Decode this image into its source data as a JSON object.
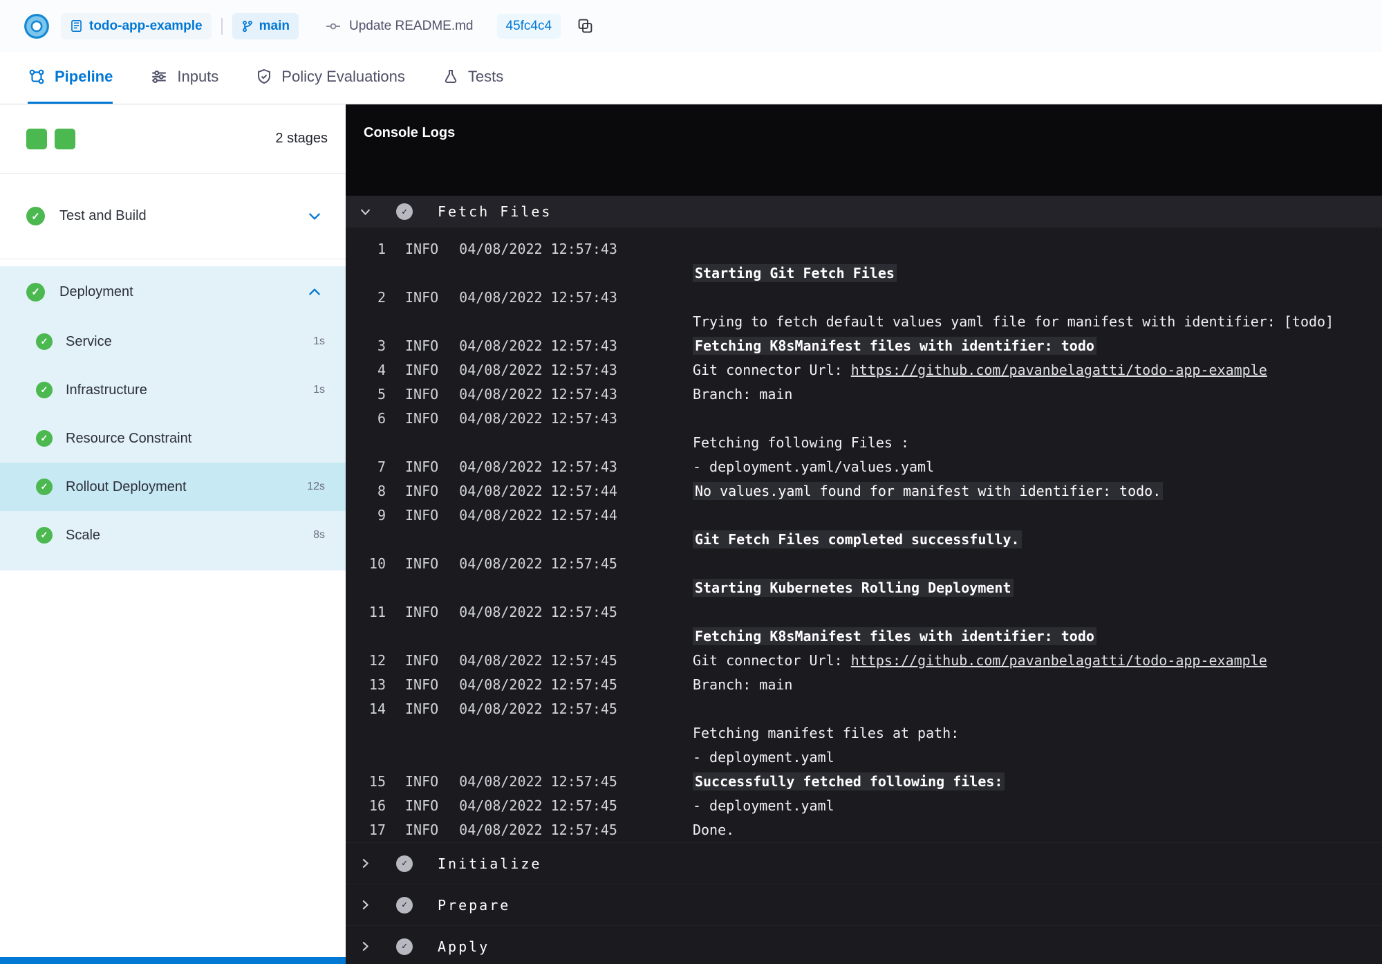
{
  "topbar": {
    "repo": "todo-app-example",
    "branch": "main",
    "commit_message": "Update README.md",
    "commit_hash": "45fc4c4"
  },
  "tabs": [
    {
      "label": "Pipeline",
      "active": true
    },
    {
      "label": "Inputs",
      "active": false
    },
    {
      "label": "Policy Evaluations",
      "active": false
    },
    {
      "label": "Tests",
      "active": false
    }
  ],
  "sidebar": {
    "stages_count_label": "2 stages",
    "stage_collapsed": {
      "label": "Test and Build"
    },
    "stage_expanded": {
      "label": "Deployment"
    },
    "deployment_steps": [
      {
        "label": "Service",
        "duration": "1s",
        "selected": false
      },
      {
        "label": "Infrastructure",
        "duration": "1s",
        "selected": false
      },
      {
        "label": "Resource Constraint",
        "duration": "",
        "selected": false
      },
      {
        "label": "Rollout Deployment",
        "duration": "12s",
        "selected": true
      },
      {
        "label": "Scale",
        "duration": "8s",
        "selected": false
      }
    ]
  },
  "console": {
    "title": "Console Logs",
    "expanded_section": "Fetch Files",
    "collapsed_sections": [
      "Initialize",
      "Prepare",
      "Apply"
    ],
    "log_entries": [
      {
        "n": 1,
        "lvl": "INFO",
        "ts": "04/08/2022 12:57:43",
        "lines": [
          [],
          [
            {
              "t": "Starting Git Fetch Files",
              "s": "hl"
            }
          ]
        ]
      },
      {
        "n": 2,
        "lvl": "INFO",
        "ts": "04/08/2022 12:57:43",
        "lines": [
          [],
          [
            {
              "t": "Trying to fetch default values yaml file for manifest with identifier: [todo]",
              "s": "plain"
            }
          ]
        ]
      },
      {
        "n": 3,
        "lvl": "INFO",
        "ts": "04/08/2022 12:57:43",
        "lines": [
          [
            {
              "t": "Fetching K8sManifest files with identifier: todo",
              "s": "hl"
            }
          ]
        ]
      },
      {
        "n": 4,
        "lvl": "INFO",
        "ts": "04/08/2022 12:57:43",
        "lines": [
          [
            {
              "t": "Git connector Url: ",
              "s": "plain"
            },
            {
              "t": "https://github.com/pavanbelagatti/todo-app-example",
              "s": "link"
            }
          ]
        ]
      },
      {
        "n": 5,
        "lvl": "INFO",
        "ts": "04/08/2022 12:57:43",
        "lines": [
          [
            {
              "t": "Branch: main",
              "s": "plain"
            }
          ]
        ]
      },
      {
        "n": 6,
        "lvl": "INFO",
        "ts": "04/08/2022 12:57:43",
        "lines": [
          [],
          [
            {
              "t": "Fetching following Files :",
              "s": "plain"
            }
          ]
        ]
      },
      {
        "n": 7,
        "lvl": "INFO",
        "ts": "04/08/2022 12:57:43",
        "lines": [
          [
            {
              "t": "- deployment.yaml/values.yaml",
              "s": "plain"
            }
          ]
        ]
      },
      {
        "n": 8,
        "lvl": "INFO",
        "ts": "04/08/2022 12:57:44",
        "lines": [
          [
            {
              "t": "No values.yaml found for manifest with identifier: todo.",
              "s": "hlplain"
            }
          ]
        ]
      },
      {
        "n": 9,
        "lvl": "INFO",
        "ts": "04/08/2022 12:57:44",
        "lines": [
          [],
          [
            {
              "t": "Git Fetch Files completed successfully.",
              "s": "hl"
            }
          ]
        ]
      },
      {
        "n": 10,
        "lvl": "INFO",
        "ts": "04/08/2022 12:57:45",
        "lines": [
          [],
          [
            {
              "t": "Starting Kubernetes Rolling Deployment",
              "s": "hl"
            }
          ]
        ]
      },
      {
        "n": 11,
        "lvl": "INFO",
        "ts": "04/08/2022 12:57:45",
        "lines": [
          [],
          [
            {
              "t": "Fetching K8sManifest files with identifier: todo",
              "s": "hl"
            }
          ]
        ]
      },
      {
        "n": 12,
        "lvl": "INFO",
        "ts": "04/08/2022 12:57:45",
        "lines": [
          [
            {
              "t": "Git connector Url: ",
              "s": "plain"
            },
            {
              "t": "https://github.com/pavanbelagatti/todo-app-example",
              "s": "link"
            }
          ]
        ]
      },
      {
        "n": 13,
        "lvl": "INFO",
        "ts": "04/08/2022 12:57:45",
        "lines": [
          [
            {
              "t": "Branch: main",
              "s": "plain"
            }
          ]
        ]
      },
      {
        "n": 14,
        "lvl": "INFO",
        "ts": "04/08/2022 12:57:45",
        "lines": [
          [],
          [
            {
              "t": "Fetching manifest files at path:",
              "s": "plain"
            }
          ],
          [
            {
              "t": "- deployment.yaml",
              "s": "plain"
            }
          ]
        ]
      },
      {
        "n": 15,
        "lvl": "INFO",
        "ts": "04/08/2022 12:57:45",
        "lines": [
          [
            {
              "t": "Successfully fetched following files:",
              "s": "hl"
            }
          ]
        ]
      },
      {
        "n": 16,
        "lvl": "INFO",
        "ts": "04/08/2022 12:57:45",
        "lines": [
          [
            {
              "t": "- deployment.yaml",
              "s": "plain"
            }
          ]
        ]
      },
      {
        "n": 17,
        "lvl": "INFO",
        "ts": "04/08/2022 12:57:45",
        "lines": [
          [
            {
              "t": "Done.",
              "s": "plain"
            }
          ]
        ]
      }
    ]
  },
  "colors": {
    "accent_blue": "#0278d5",
    "success_green": "#4bb850",
    "stage_section_bg": "#e3f2f8",
    "selected_step_bg": "#c7e9f3",
    "console_bg": "#1b1b1f",
    "console_header_bg": "#0a0a0c",
    "section_header_bg": "#232329",
    "highlight_bg": "#2c2c33"
  }
}
